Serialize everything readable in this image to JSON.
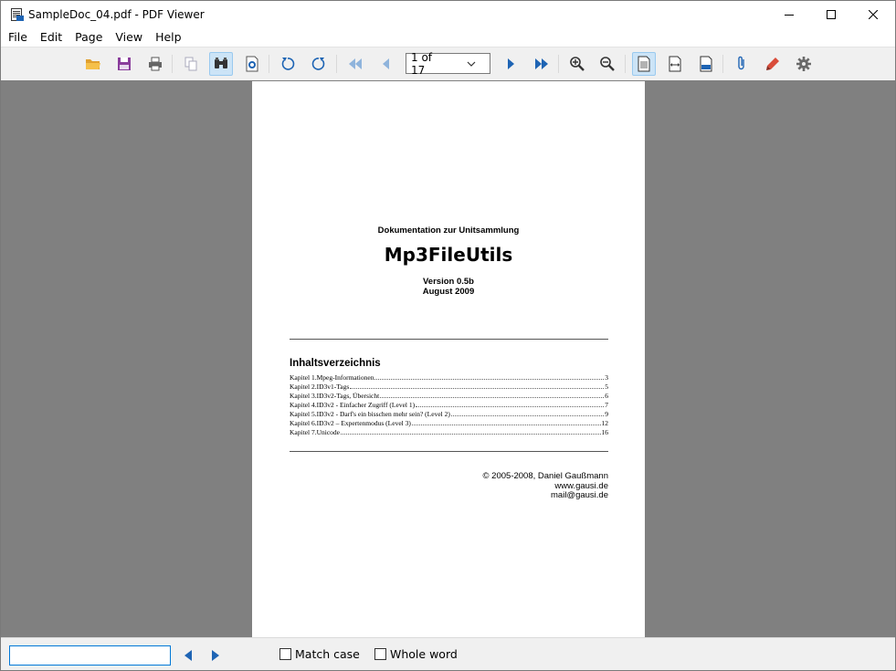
{
  "window": {
    "title": "SampleDoc_04.pdf - PDF Viewer"
  },
  "menu": {
    "items": [
      "File",
      "Edit",
      "Page",
      "View",
      "Help"
    ]
  },
  "toolbar": {
    "page_selector": "1 of 17",
    "icons": [
      "folder-open-icon",
      "save-icon",
      "print-icon",
      "copy-icon",
      "find-binoculars-icon",
      "document-settings-icon",
      "rotate-left-icon",
      "rotate-right-icon",
      "first-page-icon",
      "previous-page-icon",
      "next-page-icon",
      "last-page-icon",
      "zoom-in-icon",
      "zoom-out-icon",
      "fit-page-icon",
      "fit-width-icon",
      "actual-size-icon",
      "attachment-icon",
      "highlight-pen-icon",
      "settings-gear-icon"
    ]
  },
  "document": {
    "subtitle": "Dokumentation zur Unitsammlung",
    "title": "Mp3FileUtils",
    "version": "Version 0.5b",
    "date": "August 2009",
    "toc_heading": "Inhaltsverzeichnis",
    "toc": [
      {
        "title": "Kapitel 1.Mpeg-Informationen",
        "page": "3"
      },
      {
        "title": "Kapitel 2.ID3v1-Tags",
        "page": "5"
      },
      {
        "title": "Kapitel 3.ID3v2-Tags, Übersicht",
        "page": "6"
      },
      {
        "title": "Kapitel 4.ID3v2 - Einfacher Zugriff (Level 1)",
        "page": "7"
      },
      {
        "title": "Kapitel 5.ID3v2 - Darf's ein bisschen mehr sein? (Level 2)",
        "page": "9"
      },
      {
        "title": "Kapitel 6.ID3v2 – Expertenmodus (Level 3)",
        "page": "12"
      },
      {
        "title": "Kapitel 7.Unicode",
        "page": "16"
      }
    ],
    "copyright": "© 2005-2008, Daniel Gaußmann",
    "website": "www.gausi.de",
    "email": "mail@gausi.de"
  },
  "findbar": {
    "value": "",
    "match_case_label": "Match case",
    "whole_word_label": "Whole word"
  },
  "colors": {
    "accent": "#0078d7",
    "viewer_background": "#808080",
    "toolbar_background": "#f0f0f0",
    "nav_blue": "#1e64b4"
  }
}
